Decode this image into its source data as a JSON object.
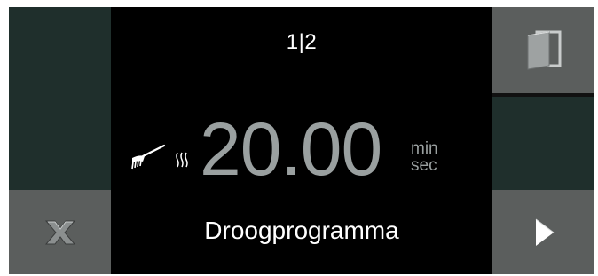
{
  "header": {
    "page_indicator": "1|2"
  },
  "timer": {
    "value": "20.00",
    "unit_top": "min",
    "unit_bottom": "sec"
  },
  "program": {
    "name": "Droogprogramma"
  },
  "icons": {
    "cancel": "close-icon",
    "door": "door-icon",
    "next": "play-arrow-icon",
    "brush": "brush-icon",
    "steam": "steam-icon"
  },
  "colors": {
    "button_bg": "#5b5e5d",
    "dark_panel": "#1f2f2c",
    "screen_bg": "#000000",
    "time_text": "#9aa0a0"
  }
}
